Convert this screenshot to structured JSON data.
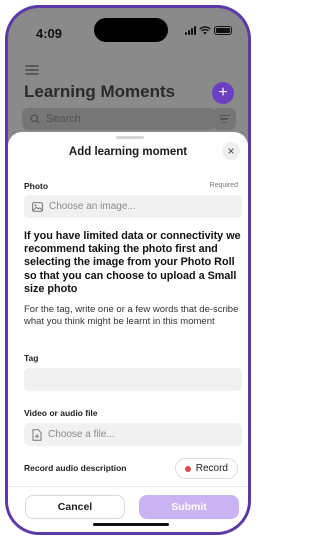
{
  "status_bar": {
    "time": "4:09"
  },
  "background_page": {
    "title": "Learning Moments",
    "add_label": "+",
    "search_placeholder": "Search"
  },
  "sheet": {
    "title": "Add learning moment",
    "close_label": "×",
    "photo": {
      "label": "Photo",
      "required_label": "Required",
      "placeholder": "Choose an image..."
    },
    "notice": "If you have limited data or connectivity we recommend taking the photo first and selecting the image from your Photo Roll so that you can choose to upload a Small size photo",
    "hint": "For the tag, write one or a few words that de-scribe what you think might be learnt in this moment",
    "tag": {
      "label": "Tag",
      "value": ""
    },
    "file": {
      "label": "Video or audio file",
      "placeholder": "Choose a file..."
    },
    "audio": {
      "label": "Record audio description",
      "button_label": "Record"
    },
    "footer": {
      "cancel_label": "Cancel",
      "submit_label": "Submit"
    }
  },
  "colors": {
    "accent": "#6a3fc4",
    "submit_disabled": "#c9b3f3",
    "record_dot": "#e04a4a",
    "frame": "#5b3aa8"
  }
}
